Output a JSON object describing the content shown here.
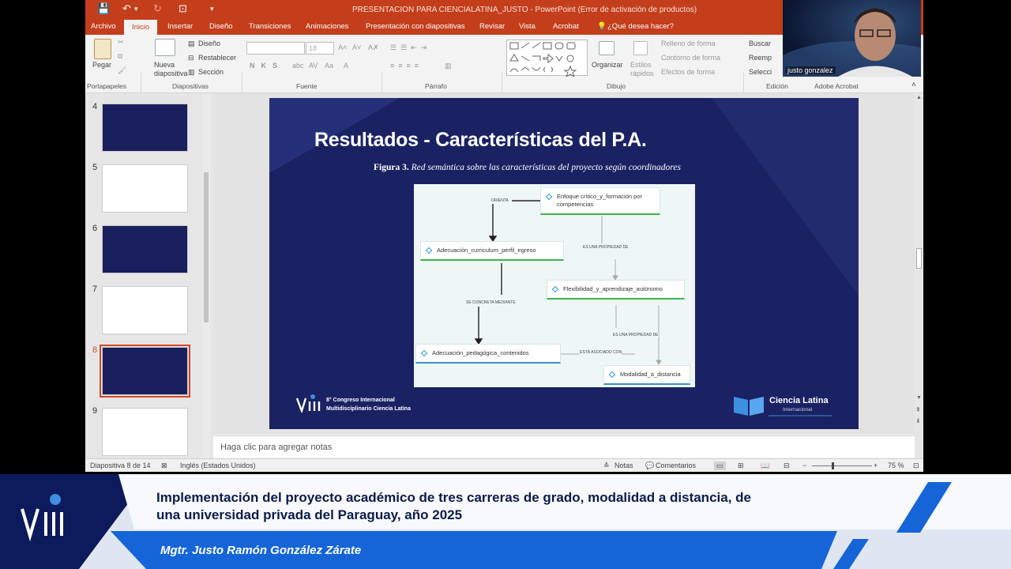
{
  "window": {
    "title": "PRESENTACION PARA CIENCIALATINA_JUSTO - PowerPoint (Error de activación de productos)"
  },
  "tabs": [
    "Archivo",
    "Inicio",
    "Insertar",
    "Diseño",
    "Transiciones",
    "Animaciones",
    "Presentación con diapositivas",
    "Revisar",
    "Vista",
    "Acrobat"
  ],
  "tell_me": "¿Qué desea hacer?",
  "ribbon": {
    "pegar": "Pegar",
    "nueva_diapositiva": "Nueva diapositiva",
    "diseno": "Diseño",
    "restablecer": "Restablecer",
    "seccion": "Sección",
    "font_size": "18",
    "organizar": "Organizar",
    "estilos_rapidos": "Estilos rápidos",
    "relleno": "Relleno de forma",
    "contorno": "Contorno de forma",
    "efectos": "Efectos de forma",
    "buscar": "Buscar",
    "reemplazar": "Reemp",
    "seleccionar": "Selecci",
    "groups": {
      "portapapeles": "Portapapeles",
      "diapositivas": "Diapositivas",
      "fuente": "Fuente",
      "parrafo": "Párrafo",
      "dibujo": "Dibujo",
      "edicion": "Edición",
      "acrobat": "Adobe Acrobat"
    }
  },
  "thumbnails": [
    {
      "num": "4",
      "theme": "dark"
    },
    {
      "num": "5",
      "theme": "light"
    },
    {
      "num": "6",
      "theme": "dark"
    },
    {
      "num": "7",
      "theme": "light"
    },
    {
      "num": "8",
      "theme": "dark"
    },
    {
      "num": "9",
      "theme": "light"
    }
  ],
  "slide": {
    "title": "Resultados - Características del P.A.",
    "figure_label": "Figura 3.",
    "figure_caption": "Red semántica sobre las características del proyecto según coordinadores",
    "nodes": {
      "enfoque": "Enfoque crítico_y_formación por competencias",
      "adecuacion_curriculum": "Adecuación_curriculum_perfil_egreso",
      "flexibilidad": "Flexibilidad_y_aprendizaje_autónomo",
      "adecuacion_pedagogica": "Adecuación_pedagógica_contenidos",
      "modalidad": "Modalidad_a_distancia"
    },
    "edges": {
      "orienta": "ORIENTA",
      "propiedad1": "ES UNA PROPIEDAD DE",
      "concreta": "SE CONCRETA MEDIANTE",
      "propiedad2": "ES UNA PROPIEDAD DE",
      "asociado": "ESTÁ ASOCIADO CON"
    },
    "congress_line1": "8° Congreso Internacional",
    "congress_line2": "Multidisciplinario Ciencia Latina",
    "brand": "Ciencia Latina",
    "brand_sub": "Internacional"
  },
  "notes_placeholder": "Haga clic para agregar notas",
  "status": {
    "slide_info": "Diapositiva 8 de 14",
    "language": "Inglés (Estados Unidos)",
    "notas": "Notas",
    "comentarios": "Comentarios",
    "zoom": "75 %"
  },
  "camera": {
    "name": "justo gonzalez"
  },
  "banner": {
    "title_line1": "Implementación del proyecto académico de tres carreras de grado, modalidad a distancia, de",
    "title_line2": "una universidad privada del Paraguay, año 2025",
    "author": "Mgtr. Justo Ramón González Zárate"
  },
  "colors": {
    "accent": "#c43e1c",
    "slide_bg": "#1b2263",
    "banner_blue": "#1565d8"
  }
}
